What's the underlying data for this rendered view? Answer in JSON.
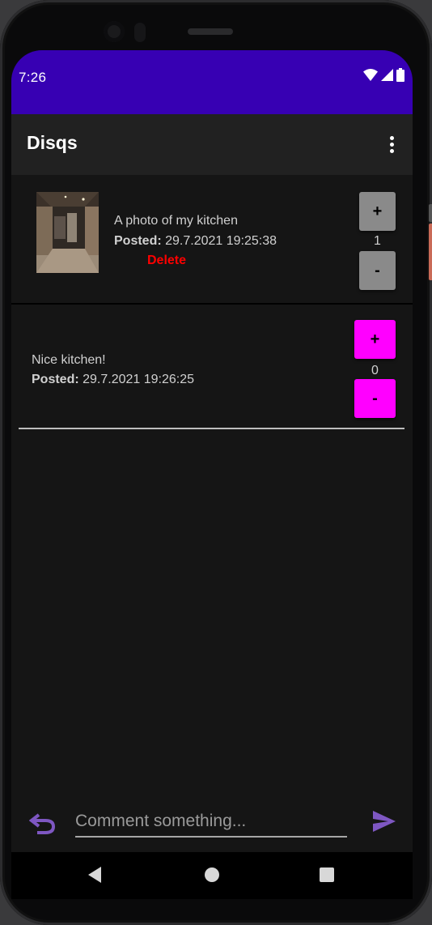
{
  "status_bar": {
    "time": "7:26",
    "color": "#3700b3"
  },
  "app_bar": {
    "title": "Disqs",
    "menu_icon": "more-vert-icon"
  },
  "post": {
    "caption": "A photo of my kitchen",
    "posted_label": "Posted:",
    "posted_time": "29.7.2021 19:25:38",
    "delete_label": "Delete",
    "upvote_label": "+",
    "downvote_label": "-",
    "score": "1"
  },
  "comments": [
    {
      "text": "Nice kitchen!",
      "posted_label": "Posted:",
      "posted_time": "29.7.2021 19:26:25",
      "upvote_label": "+",
      "downvote_label": "-",
      "score": "0"
    }
  ],
  "comment_bar": {
    "placeholder": "Comment something...",
    "undo_icon": "undo-icon",
    "send_icon": "send-icon"
  },
  "nav_bar": {
    "back_icon": "back-triangle-icon",
    "home_icon": "home-circle-icon",
    "recents_icon": "recents-square-icon"
  },
  "colors": {
    "accent": "#ff00ff",
    "delete": "#ff0000",
    "primary_dark": "#3700b3",
    "icon_purple": "#7e57c2"
  }
}
